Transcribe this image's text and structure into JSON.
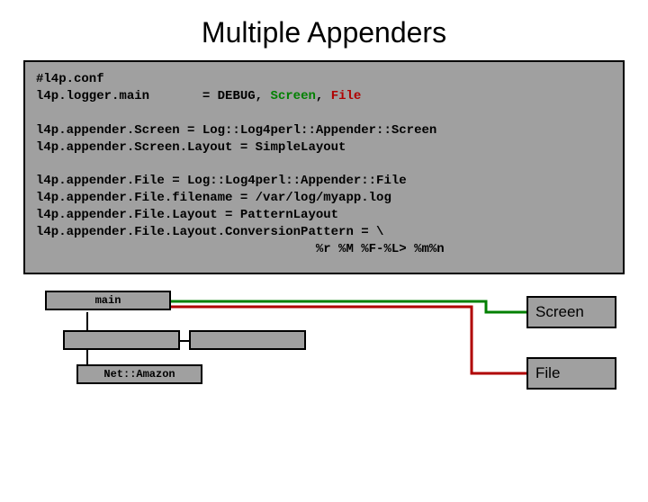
{
  "title": "Multiple Appenders",
  "code": {
    "l1a": "#l4p.conf",
    "l2a": "l4p.logger.main",
    "l2b": "= DEBUG, ",
    "l2c": "Screen",
    "l2d": ", ",
    "l2e": "File",
    "l3": "l4p.appender.Screen = Log::Log4perl::Appender::Screen",
    "l4": "l4p.appender.Screen.Layout = SimpleLayout",
    "l5": "l4p.appender.File = Log::Log4perl::Appender::File",
    "l6": "l4p.appender.File.filename = /var/log/myapp.log",
    "l7": "l4p.appender.File.Layout = PatternLayout",
    "l8": "l4p.appender.File.Layout.ConversionPattern = \\",
    "l9": "                                     %r %M %F-%L> %m%n"
  },
  "diagram": {
    "main": "main",
    "net": "Net::Amazon",
    "screen": "Screen",
    "file": "File"
  }
}
